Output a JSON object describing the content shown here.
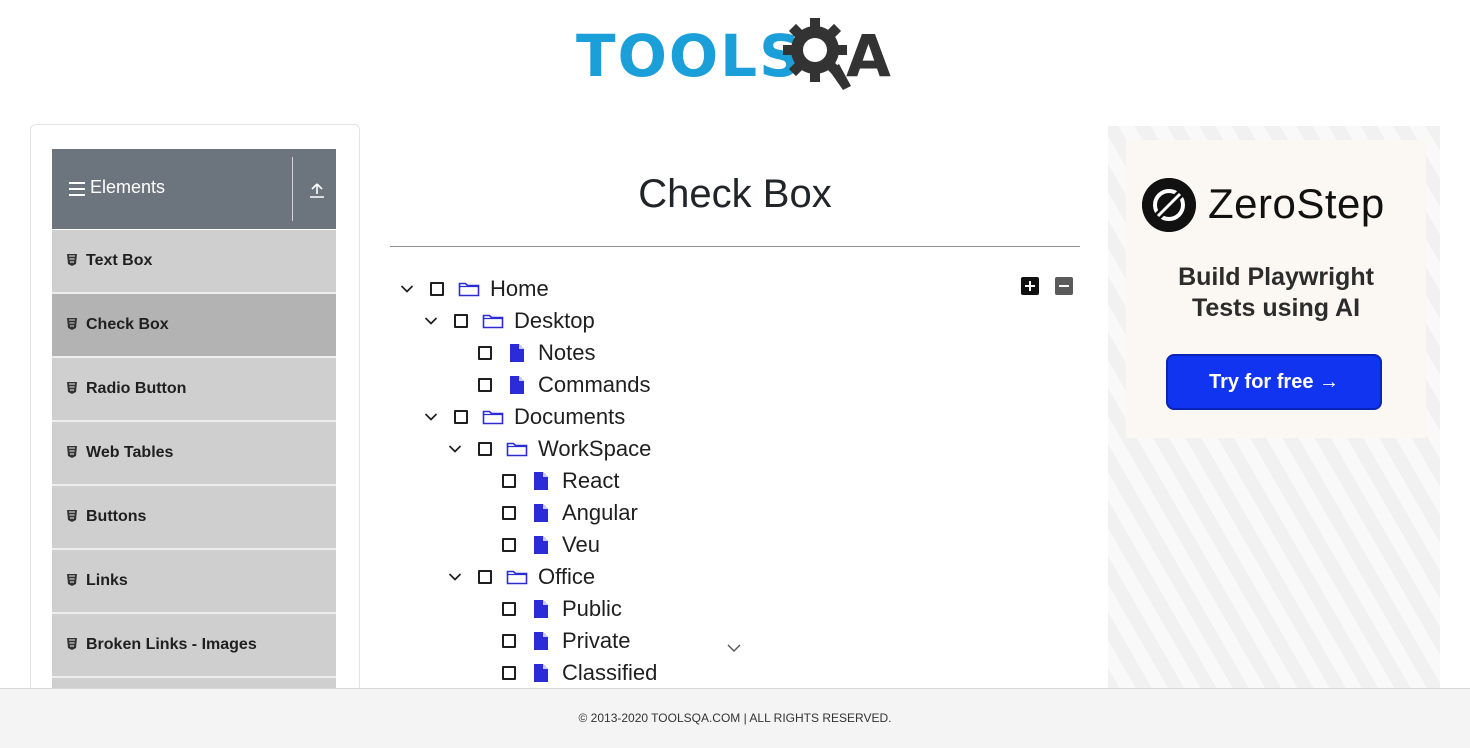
{
  "header": {
    "logo_text": "TOOLS",
    "logo_suffix": "A",
    "logo_alt": "TOOLSQA"
  },
  "sidebar": {
    "group_title": "Elements",
    "items": [
      {
        "label": "Text Box",
        "active": false
      },
      {
        "label": "Check Box",
        "active": true
      },
      {
        "label": "Radio Button",
        "active": false
      },
      {
        "label": "Web Tables",
        "active": false
      },
      {
        "label": "Buttons",
        "active": false
      },
      {
        "label": "Links",
        "active": false
      },
      {
        "label": "Broken Links - Images",
        "active": false
      }
    ]
  },
  "main": {
    "title": "Check Box",
    "tree": [
      {
        "label": "Home",
        "type": "folder",
        "expanded": true
      },
      {
        "label": "Desktop",
        "type": "folder",
        "expanded": true
      },
      {
        "label": "Notes",
        "type": "file"
      },
      {
        "label": "Commands",
        "type": "file"
      },
      {
        "label": "Documents",
        "type": "folder",
        "expanded": true
      },
      {
        "label": "WorkSpace",
        "type": "folder",
        "expanded": true
      },
      {
        "label": "React",
        "type": "file"
      },
      {
        "label": "Angular",
        "type": "file"
      },
      {
        "label": "Veu",
        "type": "file"
      },
      {
        "label": "Office",
        "type": "folder",
        "expanded": true
      },
      {
        "label": "Public",
        "type": "file"
      },
      {
        "label": "Private",
        "type": "file"
      },
      {
        "label": "Classified",
        "type": "file"
      }
    ],
    "expand_all_icon": "plus-square-icon",
    "collapse_all_icon": "minus-square-icon"
  },
  "ad": {
    "brand": "ZeroStep",
    "tagline_line1": "Build Playwright",
    "tagline_line2": "Tests using AI",
    "cta": "Try for free →",
    "cta_color": "#1034f0"
  },
  "footer": {
    "text": "© 2013-2020 TOOLSQA.COM | ALL RIGHTS RESERVED."
  },
  "colors": {
    "logo_blue": "#1b9fd8",
    "tree_icon": "#2b2bd9",
    "menu_header": "#6c757d"
  }
}
